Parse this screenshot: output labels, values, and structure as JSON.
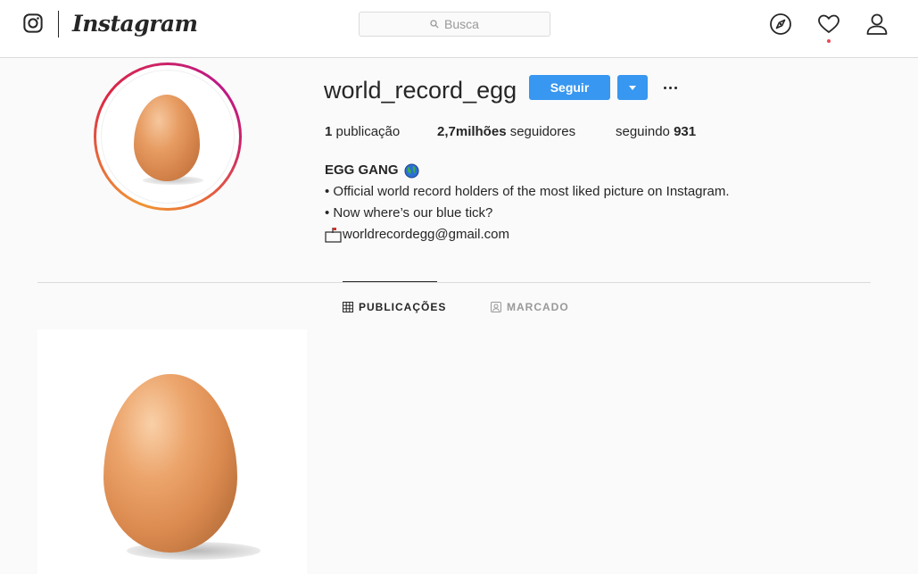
{
  "nav": {
    "wordmark": "Instagram",
    "search_placeholder": "Busca"
  },
  "profile": {
    "username": "world_record_egg",
    "follow_label": "Seguir",
    "stats": {
      "posts_count": "1",
      "posts_label": "publicação",
      "followers_count": "2,7milhões",
      "followers_label": "seguidores",
      "following_label": "seguindo",
      "following_count": "931"
    },
    "bio": {
      "name": "EGG GANG",
      "line1": "• Official world record holders of the most liked picture on Instagram.",
      "line2": "• Now where’s our blue tick?",
      "email": "worldrecordegg@gmail.com"
    }
  },
  "tabs": {
    "posts": "PUBLICAÇÕES",
    "tagged": "MARCADO"
  },
  "colors": {
    "accent": "#3897f0",
    "notification": "#ed4956"
  }
}
